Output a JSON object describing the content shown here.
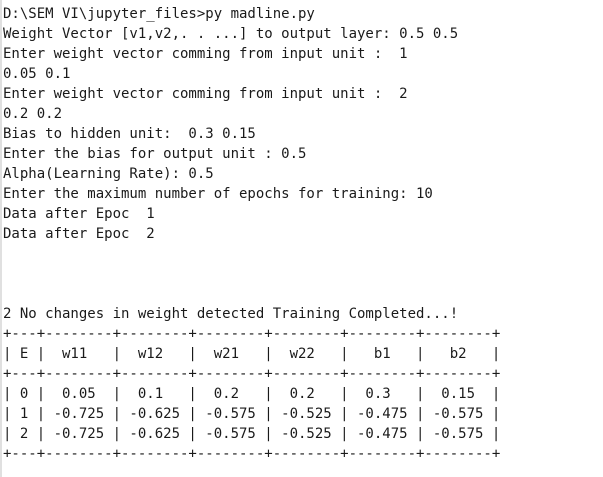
{
  "console": {
    "lines": [
      "D:\\SEM VI\\jupyter_files>py madline.py",
      "Weight Vector [v1,v2,. . ...] to output layer: 0.5 0.5",
      "Enter weight vector comming from input unit :  1",
      "0.05 0.1",
      "Enter weight vector comming from input unit :  2",
      "0.2 0.2",
      "Bias to hidden unit:  0.3 0.15",
      "Enter the bias for output unit : 0.5",
      "Alpha(Learning Rate): 0.5",
      "Enter the maximum number of epochs for training: 10",
      "Data after Epoc  1",
      "Data after Epoc  2",
      "",
      "",
      "",
      "2 No changes in weight detected Training Completed...!",
      "+---+--------+--------+--------+--------+--------+--------+",
      "| E |  w11   |  w12   |  w21   |  w22   |   b1   |   b2   |",
      "+---+--------+--------+--------+--------+--------+--------+",
      "| 0 |  0.05  |  0.1   |  0.2   |  0.2   |  0.3   |  0.15  |",
      "| 1 | -0.725 | -0.625 | -0.575 | -0.525 | -0.475 | -0.575 |",
      "| 2 | -0.725 | -0.625 | -0.575 | -0.525 | -0.475 | -0.575 |",
      "+---+--------+--------+--------+--------+--------+--------+"
    ]
  }
}
